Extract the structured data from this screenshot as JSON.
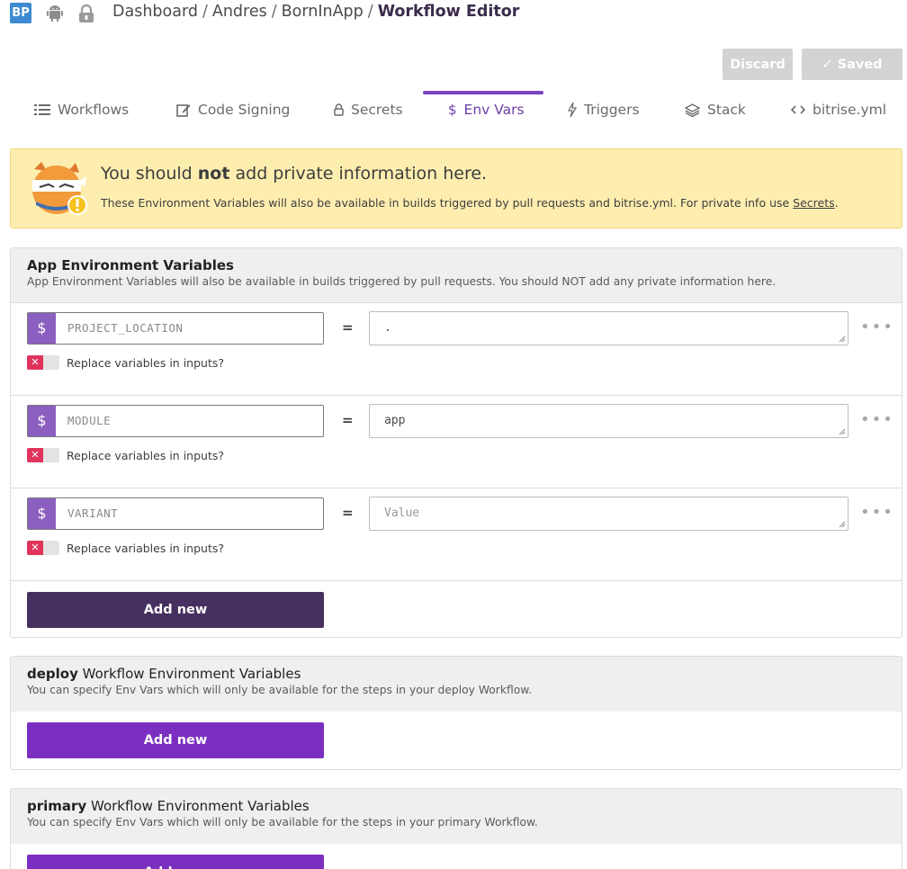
{
  "header": {
    "app_badge": "BP",
    "breadcrumb": [
      "Dashboard",
      "Andres",
      "BornInApp"
    ],
    "current_page": "Workflow Editor",
    "discard_label": "Discard",
    "saved_label": "✓ Saved"
  },
  "tabs": [
    {
      "label": "Workflows",
      "icon": "list-icon"
    },
    {
      "label": "Code Signing",
      "icon": "edit-icon"
    },
    {
      "label": "Secrets",
      "icon": "lock-icon"
    },
    {
      "label": "Env Vars",
      "icon": "dollar-icon",
      "active": true
    },
    {
      "label": "Triggers",
      "icon": "lightning-icon"
    },
    {
      "label": "Stack",
      "icon": "layers-icon"
    },
    {
      "label": "bitrise.yml",
      "icon": "code-icon"
    }
  ],
  "warning": {
    "title_pre": "You should ",
    "title_bold": "not",
    "title_post": " add private information here.",
    "text_pre": "These Environment Variables will also be available in builds triggered by pull requests and bitrise.yml. For private info use ",
    "text_link": "Secrets",
    "text_post": "."
  },
  "app_env": {
    "title": "App Environment Variables",
    "description": "App Environment Variables will also be available in builds triggered by pull requests. You should NOT add any private information here.",
    "rows": [
      {
        "key": "PROJECT_LOCATION",
        "value": ".",
        "value_placeholder": "",
        "toggle_label": "Replace variables in inputs?"
      },
      {
        "key": "MODULE",
        "value": "app",
        "value_placeholder": "",
        "toggle_label": "Replace variables in inputs?"
      },
      {
        "key": "VARIANT",
        "value": "",
        "value_placeholder": "Value",
        "toggle_label": "Replace variables in inputs?"
      }
    ],
    "add_label": "Add new"
  },
  "deploy_env": {
    "title_bold": "deploy",
    "title_rest": " Workflow Environment Variables",
    "description": "You can specify Env Vars which will only be available for the steps in your deploy Workflow.",
    "add_label": "Add new"
  },
  "primary_env": {
    "title_bold": "primary",
    "title_rest": " Workflow Environment Variables",
    "description": "You can specify Env Vars which will only be available for the steps in your primary Workflow.",
    "add_label": "Add new"
  },
  "colors": {
    "accent": "#7a41be",
    "badge": "#3d8ad0",
    "warning_bg": "#fdeeb0",
    "toggle_off": "#e0345d"
  }
}
